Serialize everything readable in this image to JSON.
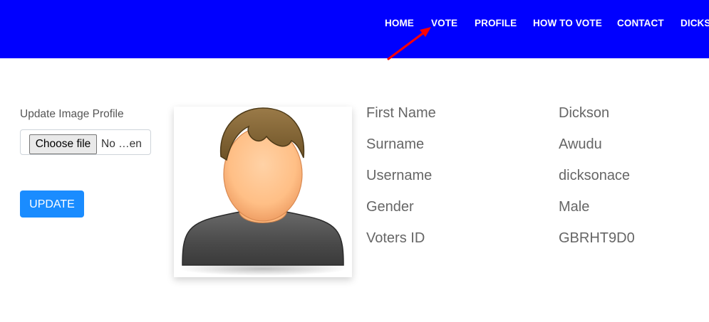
{
  "nav": {
    "items": [
      {
        "label": "HOME"
      },
      {
        "label": "VOTE"
      },
      {
        "label": "PROFILE"
      },
      {
        "label": "HOW TO VOTE"
      },
      {
        "label": "CONTACT"
      },
      {
        "label": "DICKS"
      }
    ]
  },
  "colors": {
    "navbar_bg": "#0000ff",
    "button_bg": "#1a8cff",
    "annotation_arrow": "#ff0000"
  },
  "upload": {
    "label": "Update Image Profile",
    "choose_file": "Choose file",
    "status": "No …en",
    "update_button": "UPDATE"
  },
  "avatar": {
    "icon": "default-user-avatar-icon"
  },
  "profile": {
    "fields": [
      {
        "label": "First Name",
        "value": "Dickson"
      },
      {
        "label": "Surname",
        "value": "Awudu"
      },
      {
        "label": "Username",
        "value": "dicksonace"
      },
      {
        "label": "Gender",
        "value": "Male"
      },
      {
        "label": "Voters ID",
        "value": "GBRHT9D0"
      }
    ]
  }
}
